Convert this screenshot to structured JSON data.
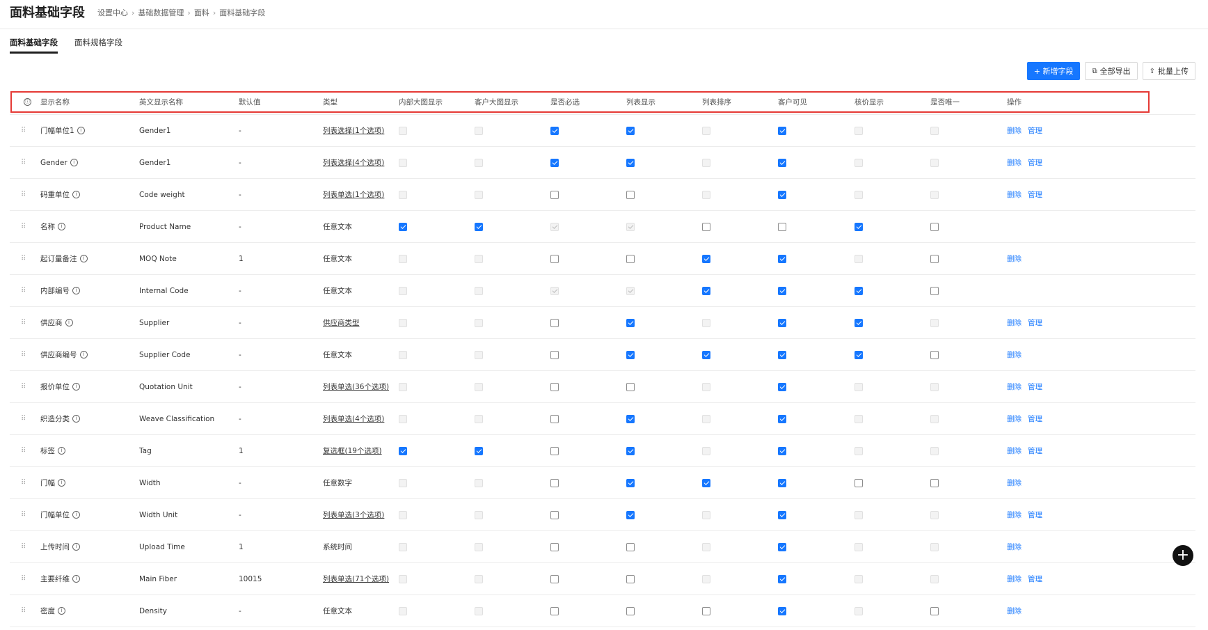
{
  "header": {
    "title": "面料基础字段",
    "breadcrumb": [
      "设置中心",
      "基础数据管理",
      "面料",
      "面料基础字段"
    ]
  },
  "tabs": [
    {
      "label": "面料基础字段",
      "active": true
    },
    {
      "label": "面料规格字段",
      "active": false
    }
  ],
  "toolbar": {
    "add_label": "+ 新增字段",
    "export_label": "全部导出",
    "upload_label": "批量上传"
  },
  "columns": {
    "info_icon": "ⓘ",
    "name": "显示名称",
    "en_name": "英文显示名称",
    "default": "默认值",
    "type": "类型",
    "internal_big": "内部大图显示",
    "customer_big": "客户大图显示",
    "required": "是否必选",
    "list_show": "列表显示",
    "list_sort": "列表排序",
    "customer_visible": "客户可见",
    "pricing_show": "核价显示",
    "unique": "是否唯一",
    "ops": "操作"
  },
  "checkbox_legend": {
    "c": "checked",
    "u": "unchecked",
    "d": "disabled",
    "x": "disabled-checked"
  },
  "rows": [
    {
      "name": "门幅单位1",
      "en": "Gender1",
      "def": "-",
      "type": "列表选择(1个选项)",
      "link": true,
      "cb": [
        "d",
        "d",
        "c",
        "c",
        "d",
        "c",
        "d",
        "d"
      ],
      "ops": [
        "删除",
        "管理"
      ]
    },
    {
      "name": "Gender",
      "en": "Gender1",
      "def": "-",
      "type": "列表选择(4个选项)",
      "link": true,
      "cb": [
        "d",
        "d",
        "c",
        "c",
        "d",
        "c",
        "d",
        "d"
      ],
      "ops": [
        "删除",
        "管理"
      ]
    },
    {
      "name": "码重单位",
      "en": "Code weight",
      "def": "-",
      "type": "列表单选(1个选项)",
      "link": true,
      "cb": [
        "d",
        "d",
        "u",
        "u",
        "d",
        "c",
        "d",
        "d"
      ],
      "ops": [
        "删除",
        "管理"
      ]
    },
    {
      "name": "名称",
      "en": "Product Name",
      "def": "-",
      "type": "任意文本",
      "link": false,
      "cb": [
        "c",
        "c",
        "x",
        "x",
        "u",
        "u",
        "c",
        "u"
      ],
      "ops": []
    },
    {
      "name": "起订量备注",
      "en": "MOQ Note",
      "def": "1",
      "type": "任意文本",
      "link": false,
      "cb": [
        "d",
        "d",
        "u",
        "u",
        "c",
        "c",
        "d",
        "u"
      ],
      "ops": [
        "删除"
      ]
    },
    {
      "name": "内部编号",
      "en": "Internal Code",
      "def": "-",
      "type": "任意文本",
      "link": false,
      "cb": [
        "d",
        "d",
        "x",
        "x",
        "c",
        "c",
        "c",
        "u"
      ],
      "ops": []
    },
    {
      "name": "供应商",
      "en": "Supplier",
      "def": "-",
      "type": "供应商类型",
      "link": true,
      "cb": [
        "d",
        "d",
        "u",
        "c",
        "d",
        "c",
        "c",
        "d"
      ],
      "ops": [
        "删除",
        "管理"
      ]
    },
    {
      "name": "供应商编号",
      "en": "Supplier Code",
      "def": "-",
      "type": "任意文本",
      "link": false,
      "cb": [
        "d",
        "d",
        "u",
        "c",
        "c",
        "c",
        "c",
        "u"
      ],
      "ops": [
        "删除"
      ]
    },
    {
      "name": "报价单位",
      "en": "Quotation Unit",
      "def": "-",
      "type": "列表单选(36个选项)",
      "link": true,
      "cb": [
        "d",
        "d",
        "u",
        "u",
        "d",
        "c",
        "d",
        "d"
      ],
      "ops": [
        "删除",
        "管理"
      ]
    },
    {
      "name": "织造分类",
      "en": "Weave Classification",
      "def": "-",
      "type": "列表单选(4个选项)",
      "link": true,
      "cb": [
        "d",
        "d",
        "u",
        "c",
        "d",
        "c",
        "d",
        "d"
      ],
      "ops": [
        "删除",
        "管理"
      ]
    },
    {
      "name": "标签",
      "en": "Tag",
      "def": "1",
      "type": "复选框(19个选项)",
      "link": true,
      "cb": [
        "c",
        "c",
        "u",
        "c",
        "d",
        "c",
        "d",
        "d"
      ],
      "ops": [
        "删除",
        "管理"
      ]
    },
    {
      "name": "门幅",
      "en": "Width",
      "def": "-",
      "type": "任意数字",
      "link": false,
      "cb": [
        "d",
        "d",
        "u",
        "c",
        "c",
        "c",
        "u",
        "u"
      ],
      "ops": [
        "删除"
      ]
    },
    {
      "name": "门幅单位",
      "en": "Width Unit",
      "def": "-",
      "type": "列表单选(3个选项)",
      "link": true,
      "cb": [
        "d",
        "d",
        "u",
        "c",
        "d",
        "c",
        "d",
        "d"
      ],
      "ops": [
        "删除",
        "管理"
      ]
    },
    {
      "name": "上传时间",
      "en": "Upload Time",
      "def": "1",
      "type": "系统时间",
      "link": false,
      "cb": [
        "d",
        "d",
        "u",
        "u",
        "d",
        "c",
        "d",
        "d"
      ],
      "ops": [
        "删除"
      ]
    },
    {
      "name": "主要纤维",
      "en": "Main Fiber",
      "def": "10015",
      "type": "列表单选(71个选项)",
      "link": true,
      "cb": [
        "d",
        "d",
        "u",
        "u",
        "d",
        "c",
        "d",
        "d"
      ],
      "ops": [
        "删除",
        "管理"
      ]
    },
    {
      "name": "密度",
      "en": "Density",
      "def": "-",
      "type": "任意文本",
      "link": false,
      "cb": [
        "d",
        "d",
        "u",
        "u",
        "u",
        "c",
        "d",
        "u"
      ],
      "ops": [
        "删除"
      ]
    }
  ],
  "fab_label": "+"
}
